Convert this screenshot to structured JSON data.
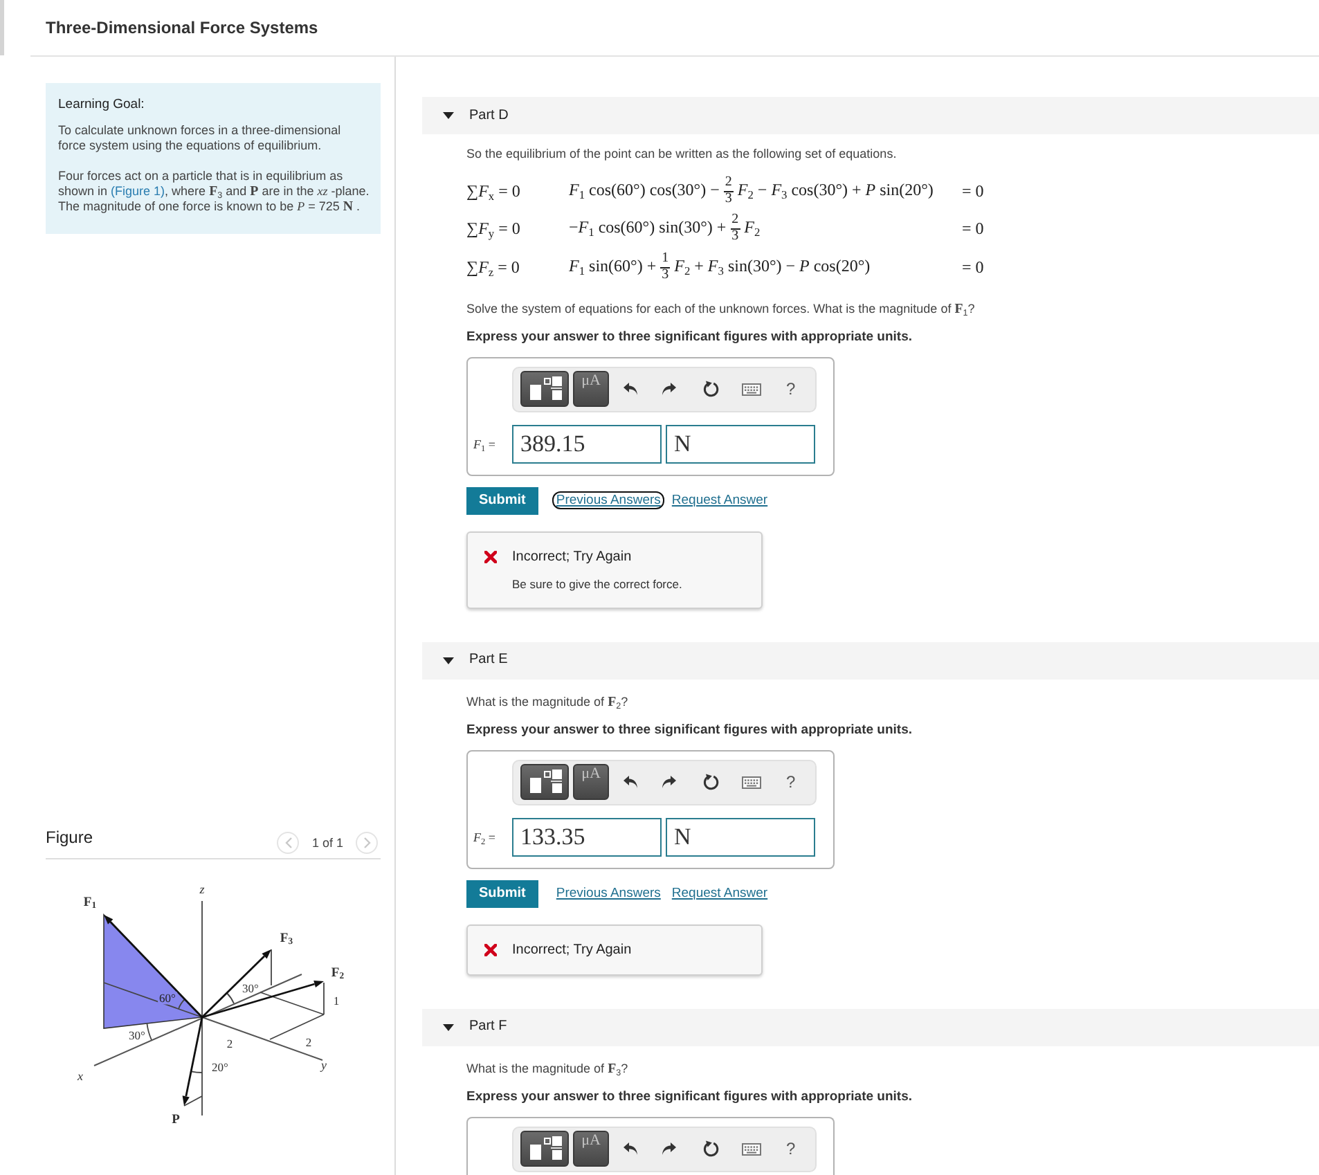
{
  "header": {
    "title": "Three-Dimensional Force Systems"
  },
  "learning_goal": {
    "heading": "Learning Goal:",
    "paragraphs": [
      {
        "text": "To calculate unknown forces in a three-dimensional force system using the equations of equilibrium."
      },
      {
        "text": "Four forces act on a particle that is in equilibrium as shown in ",
        "link": "(Figure 1)",
        "text_after": ", where **F**$_{3}$ and **P** are in the *xz* -plane. The magnitude of one force is known to be *P* = 725 **N** ."
      }
    ]
  },
  "figure": {
    "heading": "Figure",
    "pager": {
      "indicator": "1 of 1",
      "previous": {
        "disabled": true
      },
      "next": {
        "disabled": true
      }
    },
    "labels": [
      {
        "kind": "force",
        "text": "F$_{1}$"
      },
      {
        "kind": "axis",
        "text": "z"
      },
      {
        "kind": "force",
        "text": "F$_{3}$"
      },
      {
        "kind": "force",
        "text": "F$_{2}$"
      },
      {
        "kind": "angle",
        "text": "30°"
      },
      {
        "kind": "dimension",
        "text": "1"
      },
      {
        "kind": "angle",
        "text": "60°"
      },
      {
        "kind": "angle",
        "text": "30°"
      },
      {
        "kind": "dimension",
        "text": "2"
      },
      {
        "kind": "dimension",
        "text": "2"
      },
      {
        "kind": "axis",
        "text": "y"
      },
      {
        "kind": "axis",
        "text": "x"
      },
      {
        "kind": "angle",
        "text": "20°"
      },
      {
        "kind": "force",
        "text": "P"
      }
    ]
  },
  "parts": [
    {
      "label": "Part D",
      "expanded": true,
      "intro": "So the equilibrium of the point can be written as the following set of equations.",
      "equations": [
        {
          "sum": "∑*F*$_{x}$ = 0",
          "terms": [
            {
              "kind": "text",
              "text": "*F*$_{1}$ cos(60°) cos(30°) −"
            },
            {
              "kind": "fraction",
              "numerator": "2",
              "denominator": "3"
            },
            {
              "kind": "text",
              "text": "*F*$_{2}$ − *F*$_{3}$ cos(30°) + *P* sin(20°)"
            }
          ],
          "result": "= 0"
        },
        {
          "sum": "∑*F*$_{y}$ = 0",
          "terms": [
            {
              "kind": "text",
              "text": "−*F*$_{1}$ cos(60°) sin(30°) +"
            },
            {
              "kind": "fraction",
              "numerator": "2",
              "denominator": "3"
            },
            {
              "kind": "text",
              "text": "*F*$_{2}$"
            }
          ],
          "result": "= 0"
        },
        {
          "sum": "∑*F*$_{z}$ = 0",
          "terms": [
            {
              "kind": "text",
              "text": "*F*$_{1}$ sin(60°) +"
            },
            {
              "kind": "fraction",
              "numerator": "1",
              "denominator": "3"
            },
            {
              "kind": "text",
              "text": "*F*$_{2}$ + *F*$_{3}$ sin(30°) − *P* cos(20°)"
            }
          ],
          "result": "= 0"
        }
      ],
      "question": "Solve the system of equations for each of the unknown forces. What is the magnitude of **F**$_{1}$?",
      "instruction": "Express your answer to three significant figures with appropriate units.",
      "answer": {
        "toolbar": {
          "units": "μA",
          "help": "?"
        },
        "variable": "*F*$_{1}$ =",
        "value": "389.15",
        "unit": "N"
      },
      "submit": "Submit",
      "links": [
        {
          "label": "Previous Answers",
          "focused": true
        },
        {
          "label": "Request Answer",
          "focused": false
        }
      ],
      "feedback": {
        "title": "Incorrect; Try Again",
        "message": "Be sure to give the correct force."
      }
    },
    {
      "label": "Part E",
      "expanded": true,
      "question": "What is the magnitude of **F**$_{2}$?",
      "instruction": "Express your answer to three significant figures with appropriate units.",
      "answer": {
        "toolbar": {
          "units": "μA",
          "help": "?"
        },
        "variable": "*F*$_{2}$ =",
        "value": "133.35",
        "unit": "N"
      },
      "submit": "Submit",
      "links": [
        {
          "label": "Previous Answers",
          "focused": false
        },
        {
          "label": "Request Answer",
          "focused": false
        }
      ],
      "feedback": {
        "title": "Incorrect; Try Again"
      }
    },
    {
      "label": "Part F",
      "expanded": true,
      "question": "What is the magnitude of **F**$_{3}$?",
      "instruction": "Express your answer to three significant figures with appropriate units.",
      "answer": {
        "toolbar": {
          "units": "μA",
          "help": "?"
        }
      }
    }
  ]
}
